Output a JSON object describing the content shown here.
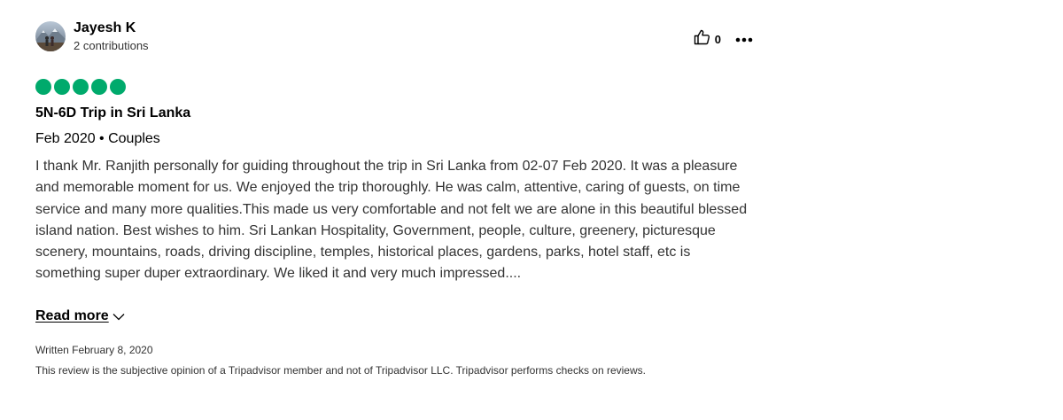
{
  "review": {
    "author": {
      "name": "Jayesh K",
      "contributions": "2 contributions"
    },
    "helpful_count": "0",
    "rating": 5,
    "title": "5N-6D Trip in Sri Lanka",
    "meta": "Feb 2020 • Couples",
    "body": "I thank Mr. Ranjith personally for guiding throughout the trip in Sri Lanka from 02-07 Feb 2020. It was a pleasure and memorable moment for us. We enjoyed the trip thoroughly. He was calm, attentive, caring of guests, on time service and many more qualities.This made us very comfortable and not felt we are alone in this beautiful blessed island nation. Best wishes to him. Sri Lankan Hospitality, Government, people, culture, greenery, picturesque scenery, mountains, roads, driving discipline, temples, historical places, gardens, parks, hotel staff, etc is something super duper extraordinary. We liked it and very much impressed....",
    "read_more_label": "Read more",
    "written_date": "Written February 8, 2020",
    "disclaimer": "This review is the subjective opinion of a Tripadvisor member and not of Tripadvisor LLC. Tripadvisor performs checks on reviews."
  },
  "colors": {
    "rating_bubble": "#00aa6c",
    "text": "#333333",
    "heading": "#000000"
  },
  "icons": [
    "thumbs-up-icon",
    "more-options-icon",
    "chevron-down-icon"
  ]
}
